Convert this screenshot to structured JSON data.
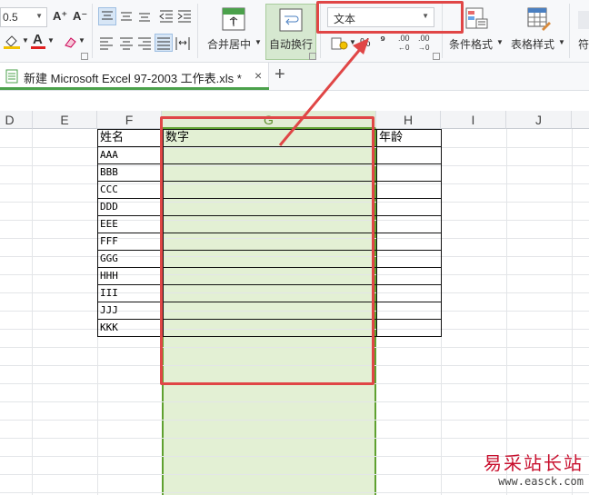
{
  "ribbon": {
    "font_size": "0.5",
    "grow_font": "A⁺",
    "shrink_font": "A⁻",
    "merge_label": "合并居中",
    "wrap_label": "自动换行",
    "number_format": "文本",
    "percent": "%",
    "comma": "⁹",
    "inc_decimal": ".00",
    "dec_decimal": ".00",
    "cond_format_label": "条件格式",
    "table_style_label": "表格样式",
    "next_label": "符"
  },
  "tabbar": {
    "doc_title": "新建 Microsoft Excel 97-2003 工作表.xls *",
    "close": "×",
    "add": "+"
  },
  "grid": {
    "columns": [
      "D",
      "E",
      "F",
      "G",
      "H",
      "I",
      "J"
    ],
    "selected_column": "G",
    "headers": [
      "姓名",
      "数字",
      "年龄"
    ],
    "names": [
      "AAA",
      "BBB",
      "CCC",
      "DDD",
      "EEE",
      "FFF",
      "GGG",
      "HHH",
      "III",
      "JJJ",
      "KKK"
    ]
  },
  "watermark": {
    "line1": "易采站长站",
    "line2": "www.easck.com"
  },
  "colors": {
    "highlight": "#e04646",
    "selection": "#e3f0d4",
    "selection_border": "#5fa130"
  }
}
